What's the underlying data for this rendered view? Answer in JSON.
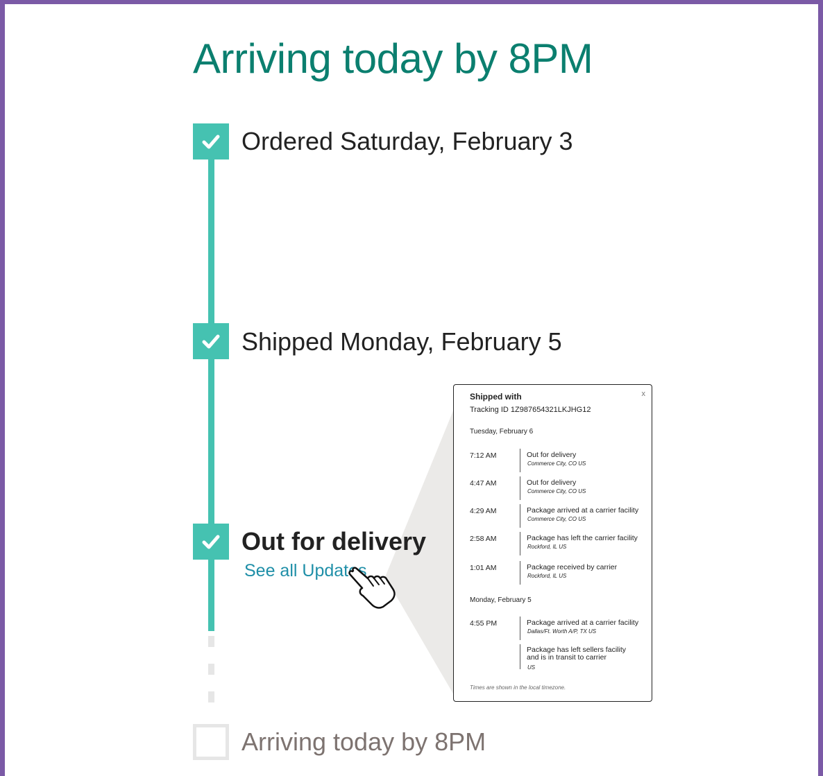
{
  "header": {
    "title": "Arriving today by 8PM"
  },
  "steps": [
    {
      "label": "Ordered Saturday, February 3",
      "status": "complete"
    },
    {
      "label": "Shipped Monday, February 5",
      "status": "complete"
    },
    {
      "label": "Out for delivery",
      "status": "current",
      "link": "See all Updates"
    },
    {
      "label": "Arriving today by 8PM",
      "status": "pending"
    }
  ],
  "popup": {
    "close": "x",
    "title": "Shipped with",
    "tracking": "Tracking ID 1Z987654321LKJHG12",
    "days": [
      {
        "date": "Tuesday, February 6",
        "events": [
          {
            "time": "7:12 AM",
            "desc": "Out for delivery",
            "loc": "Commerce City, CO US"
          },
          {
            "time": "4:47 AM",
            "desc": "Out for delivery",
            "loc": "Commerce City, CO US"
          },
          {
            "time": "4:29 AM",
            "desc": "Package arrived at a carrier facility",
            "loc": "Commerce City, CO US"
          },
          {
            "time": "2:58 AM",
            "desc": "Package has left the carrier facility",
            "loc": "Rockford, IL US"
          },
          {
            "time": "1:01 AM",
            "desc": "Package received by carrier",
            "loc": "Rockford, IL US"
          }
        ]
      },
      {
        "date": "Monday, February 5",
        "events": [
          {
            "time": "4:55 PM",
            "desc": "Package arrived at a carrier facility",
            "loc": "Dallas/Ft. Worth A/P, TX US"
          },
          {
            "time": "",
            "desc_lines": [
              "Package has left sellers facility",
              "and is in transit to carrier"
            ],
            "loc": "US"
          }
        ]
      }
    ],
    "footnote": "Times are shown in the local timezone."
  },
  "colors": {
    "accent": "#45c2b1",
    "heading": "#0b7f6f",
    "link": "#1f8fa8",
    "frame": "#7b5aa6",
    "pending": "#e6e6e6"
  }
}
